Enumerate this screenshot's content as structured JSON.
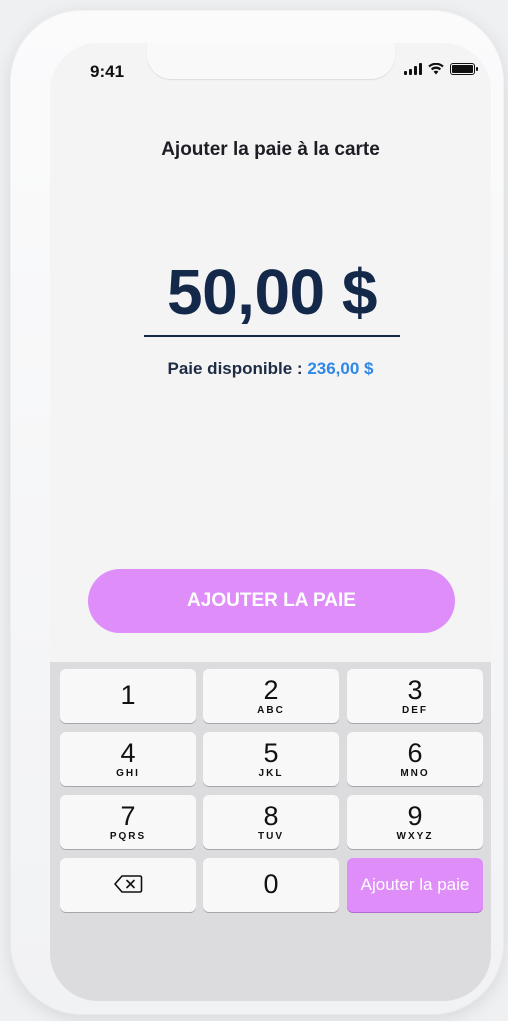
{
  "status_bar": {
    "time": "9:41"
  },
  "header": {
    "title": "Ajouter la paie à la carte"
  },
  "amount": {
    "value": "50,00 $"
  },
  "available": {
    "label": "Paie disponible :",
    "value": "236,00 $"
  },
  "cta": {
    "label": "AJOUTER LA PAIE"
  },
  "keypad": {
    "keys": [
      {
        "num": "1",
        "letters": ""
      },
      {
        "num": "2",
        "letters": "ABC"
      },
      {
        "num": "3",
        "letters": "DEF"
      },
      {
        "num": "4",
        "letters": "GHI"
      },
      {
        "num": "5",
        "letters": "JKL"
      },
      {
        "num": "6",
        "letters": "MNO"
      },
      {
        "num": "7",
        "letters": "PQRS"
      },
      {
        "num": "8",
        "letters": "TUV"
      },
      {
        "num": "9",
        "letters": "WXYZ"
      },
      {
        "num": "0",
        "letters": ""
      }
    ],
    "delete_icon": "backspace-icon",
    "submit_label": "Ajouter la paie"
  },
  "colors": {
    "accent": "#df8ef9",
    "amount_text": "#14294a",
    "available_value": "#2f87e6"
  }
}
